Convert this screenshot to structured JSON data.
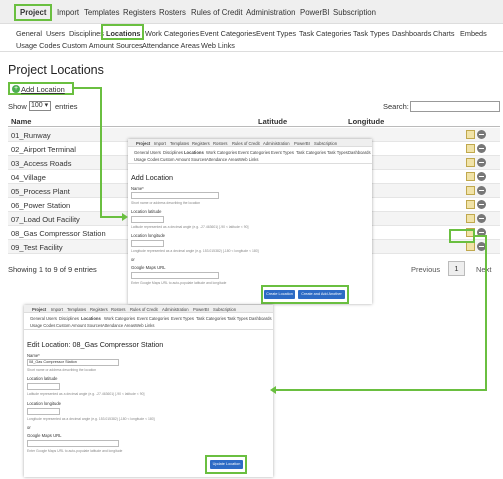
{
  "topnav": {
    "items": [
      "Project",
      "Import",
      "Templates",
      "Registers",
      "Rosters",
      "Rules of Credit",
      "Administration",
      "PowerBI",
      "Subscription"
    ]
  },
  "subnav": {
    "row1": [
      "General",
      "Users",
      "Disciplines",
      "Locations",
      "Work Categories",
      "Event Categories",
      "Event Types",
      "Task Categories",
      "Task Types",
      "Dashboards",
      "Charts",
      "Embeds"
    ],
    "row2": [
      "Usage Codes",
      "Custom Amount Sources",
      "Attendance Areas",
      "Web Links"
    ]
  },
  "main": {
    "title": "Project Locations",
    "add_button": "Add Location",
    "add_icon": "+",
    "show_label": "Show",
    "entries_value": "100",
    "entries_label": "entries",
    "search_label": "Search:",
    "columns": [
      "Name",
      "Latitude",
      "Longitude"
    ],
    "rows": [
      "01_Runway",
      "02_Airport Terminal",
      "03_Access Roads",
      "04_Village",
      "05_Process Plant",
      "06_Power Station",
      "07_Load Out Facility",
      "08_Gas Compressor Station",
      "09_Test Facility"
    ],
    "summary": "Showing 1 to 9 of 9 entries",
    "pager": {
      "prev": "Previous",
      "current": "1",
      "next": "Next"
    }
  },
  "add_panel": {
    "topnav": [
      "Project",
      "Import",
      "Templates",
      "Registers",
      "Rosters",
      "Rules of Credit",
      "Administration",
      "PowerBI",
      "Subscription"
    ],
    "subnav1": [
      "General",
      "Users",
      "Disciplines",
      "Locations",
      "Work Categories",
      "Event Categories",
      "Event Types",
      "Task Categories",
      "Task Types",
      "Dashboards"
    ],
    "subnav2": [
      "Usage Codes",
      "Custom Amount Sources",
      "Attendance Areas",
      "Web Links"
    ],
    "title": "Add Location",
    "name_label": "Name*",
    "name_hint": "Short name or address describing the location",
    "lat_label": "Location latitude",
    "lat_hint": "Latitude represented as a decimal angle (e.g. -27.463601) [-90 < latitude < 90]",
    "lon_label": "Location longitude",
    "lon_hint": "Longitude represented as a decimal angle (e.g. 153.015382) [-180 < longitude < 180]",
    "or_label": "or",
    "gmaps_label": "Google Maps URL",
    "gmaps_hint": "Enter Google Maps URL to auto-populate latitude and longitude",
    "create_button": "Create Location",
    "create_another_button": "Create and Add Another"
  },
  "edit_panel": {
    "topnav": [
      "Project",
      "Import",
      "Templates",
      "Registers",
      "Rosters",
      "Rules of Credit",
      "Administration",
      "PowerBI",
      "Subscription"
    ],
    "subnav1": [
      "General",
      "Users",
      "Disciplines",
      "Locations",
      "Work Categories",
      "Event Categories",
      "Event Types",
      "Task Categories",
      "Task Types",
      "Dashboards"
    ],
    "subnav2": [
      "Usage Codes",
      "Custom Amount Sources",
      "Attendance Areas",
      "Web Links"
    ],
    "title": "Edit Location: 08_Gas Compressor Station",
    "name_label": "Name*",
    "name_value": "08_Gas Compressor Station",
    "name_hint": "Short name or address describing the location",
    "lat_label": "Location latitude",
    "lat_hint": "Latitude represented as a decimal angle (e.g. -27.463601) [-90 < latitude < 90]",
    "lon_label": "Location longitude",
    "lon_hint": "Longitude represented as a decimal angle (e.g. 153.015382) [-180 < longitude < 180]",
    "or_label": "or",
    "gmaps_label": "Google Maps URL",
    "gmaps_hint": "Enter Google Maps URL to auto-populate latitude and longitude",
    "update_button": "Update Location"
  },
  "colors": {
    "highlight": "#6abf40",
    "primary_button": "#2d6bc5",
    "nav_bg": "#efefef"
  },
  "icons": [
    "add-circle-icon",
    "edit-icon",
    "delete-icon"
  ]
}
